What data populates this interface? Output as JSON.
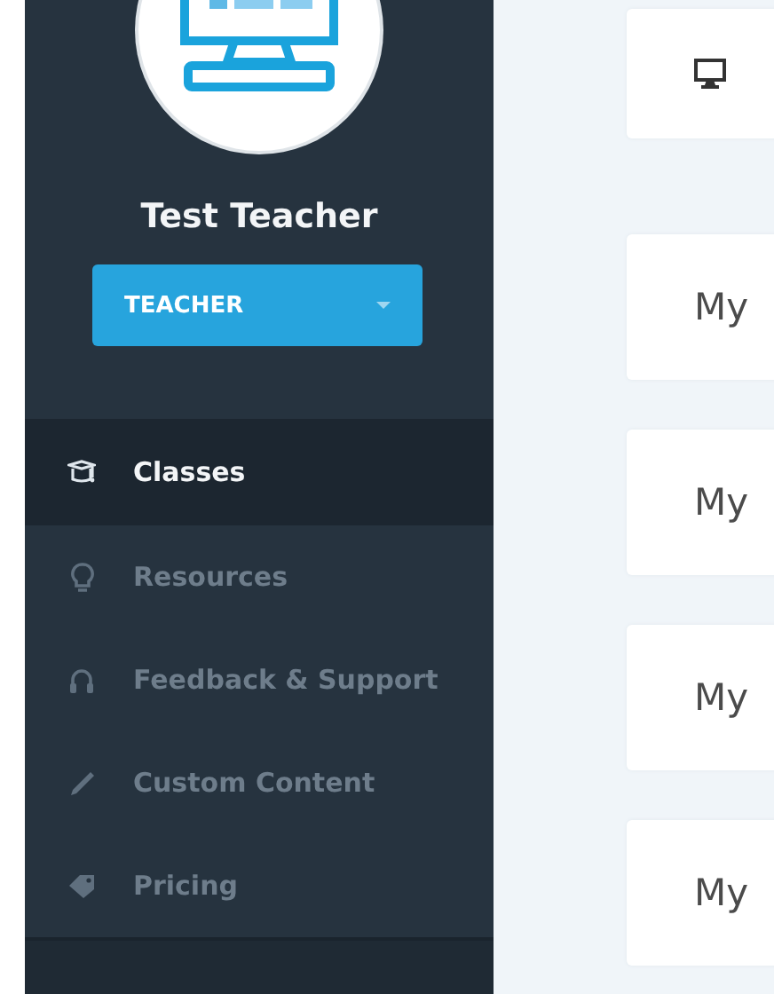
{
  "profile": {
    "name": "Test Teacher",
    "role_dropdown": {
      "value": "TEACHER"
    }
  },
  "nav": [
    {
      "label": "Classes",
      "selected": true
    },
    {
      "label": "Resources",
      "selected": false
    },
    {
      "label": "Feedback & Support",
      "selected": false
    },
    {
      "label": "Custom Content",
      "selected": false
    },
    {
      "label": "Pricing",
      "selected": false
    }
  ],
  "cards": [
    {
      "kind": "icon"
    },
    {
      "kind": "text",
      "label": "My"
    },
    {
      "kind": "text",
      "label": "My"
    },
    {
      "kind": "text",
      "label": "My"
    },
    {
      "kind": "text",
      "label": "My"
    }
  ]
}
